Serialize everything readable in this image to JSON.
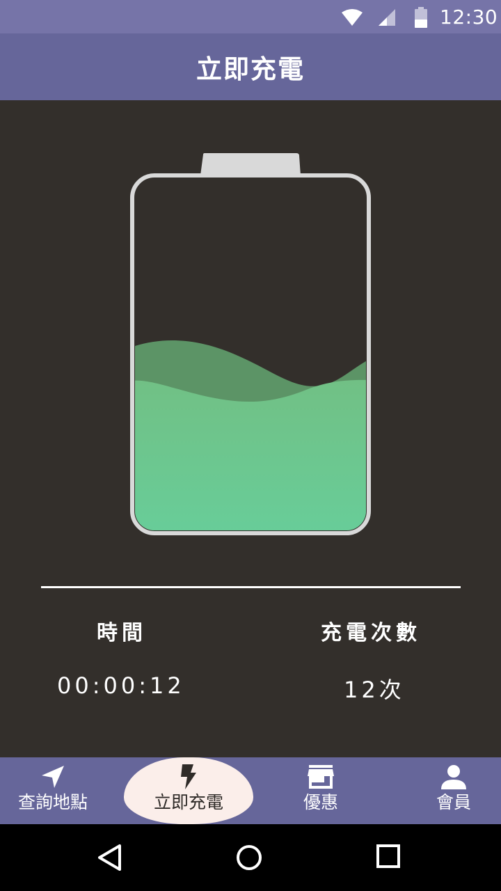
{
  "status_bar": {
    "time": "12:30",
    "icons": [
      "wifi-icon",
      "signal-icon",
      "battery-icon"
    ]
  },
  "app_bar": {
    "title": "立即充電"
  },
  "battery": {
    "charge_level_fraction": 0.48,
    "liquid_color": "#6ecb93",
    "wave_back_color": "#5e8f62",
    "frame_color": "#d9d9d9"
  },
  "stats": {
    "time_label": "時間",
    "time_value": "00:00:12",
    "count_label": "充電次數",
    "count_value": "12次"
  },
  "bottom_nav": {
    "items": [
      {
        "label": "查詢地點",
        "icon": "navigation-arrow-icon",
        "active": false
      },
      {
        "label": "立即充電",
        "icon": "lightning-bolt-icon",
        "active": true
      },
      {
        "label": "優惠",
        "icon": "store-icon",
        "active": false
      },
      {
        "label": "會員",
        "icon": "person-icon",
        "active": false
      }
    ]
  },
  "system_nav": {
    "icons": [
      "back-triangle-icon",
      "home-circle-icon",
      "recent-square-icon"
    ]
  },
  "colors": {
    "status_bar": "#7674a8",
    "app_bar": "#66669a",
    "background": "#332f2b",
    "active_tab": "#fbeeea"
  }
}
